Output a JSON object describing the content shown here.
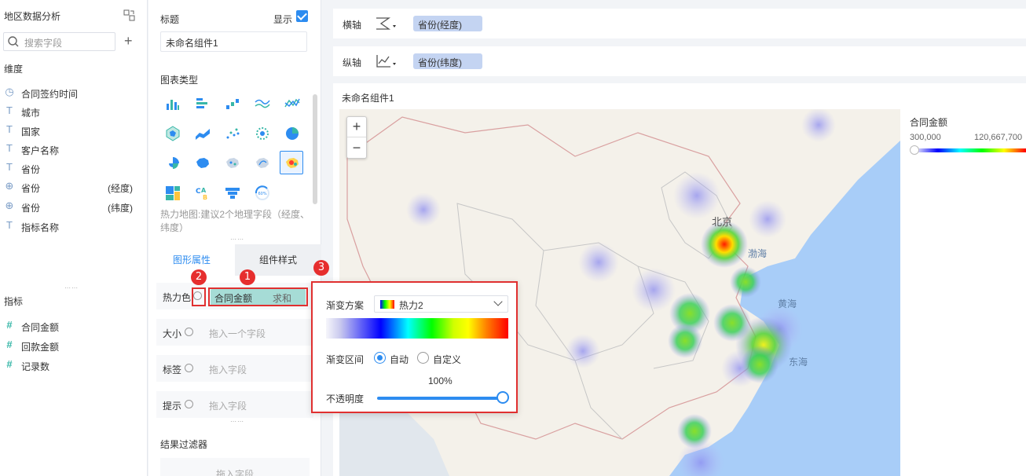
{
  "dataset": {
    "title": "地区数据分析",
    "search_placeholder": "搜索字段",
    "dimension_header": "维度",
    "dimensions": [
      {
        "icon": "clock-icon",
        "name": "合同签约时间",
        "suffix": ""
      },
      {
        "icon": "text-type-icon",
        "name": "城市",
        "suffix": ""
      },
      {
        "icon": "text-type-icon",
        "name": "国家",
        "suffix": ""
      },
      {
        "icon": "text-type-icon",
        "name": "客户名称",
        "suffix": ""
      },
      {
        "icon": "text-type-icon",
        "name": "省份",
        "suffix": ""
      },
      {
        "icon": "globe-icon",
        "name": "省份",
        "suffix": "(经度)"
      },
      {
        "icon": "globe-icon",
        "name": "省份",
        "suffix": "(纬度)"
      },
      {
        "icon": "text-type-icon",
        "name": "指标名称",
        "suffix": ""
      }
    ],
    "measure_header": "指标",
    "measures": [
      {
        "icon": "hash-icon",
        "name": "合同金额"
      },
      {
        "icon": "hash-icon",
        "name": "回款金额"
      },
      {
        "icon": "hash-icon",
        "name": "记录数"
      }
    ]
  },
  "config": {
    "title_label": "标题",
    "show_label": "显示",
    "title_value": "未命名组件1",
    "chart_type_label": "图表类型",
    "chart_type_hint": "热力地图:建议2个地理字段（经度、纬度）",
    "tabs": [
      "图形属性",
      "组件样式"
    ],
    "props": [
      {
        "label": "热力色",
        "placeholder": ""
      },
      {
        "label": "大小",
        "placeholder": "拖入一个字段"
      },
      {
        "label": "标签",
        "placeholder": "拖入字段"
      },
      {
        "label": "提示",
        "placeholder": "拖入字段"
      }
    ],
    "heat_field": {
      "name": "合同金额",
      "agg": "求和"
    },
    "filter_label": "结果过滤器",
    "filter_placeholder": "拖入字段"
  },
  "axes": {
    "x_label": "横轴",
    "x_field": "省份(经度)",
    "y_label": "纵轴",
    "y_field": "省份(纬度)"
  },
  "chart": {
    "component_title": "未命名组件1",
    "zoom_in": "+",
    "zoom_out": "−",
    "legend_title": "合同金额",
    "legend_min": "300,000",
    "legend_max": "120,667,700",
    "map_labels": [
      "北京",
      "渤海",
      "黄海",
      "东海"
    ]
  },
  "popup": {
    "scheme_label": "渐变方案",
    "scheme_value": "热力2",
    "range_label": "渐变区间",
    "range_options": [
      "自动",
      "自定义"
    ],
    "range_selected": "自动",
    "opacity_label": "不透明度",
    "opacity_value": "100%",
    "opacity_fraction": 1.0
  },
  "callouts": [
    "1",
    "2",
    "3"
  ],
  "colors": {
    "accent": "#2d8cf0",
    "callout": "#e03030",
    "sea": "#a8cdf8"
  }
}
